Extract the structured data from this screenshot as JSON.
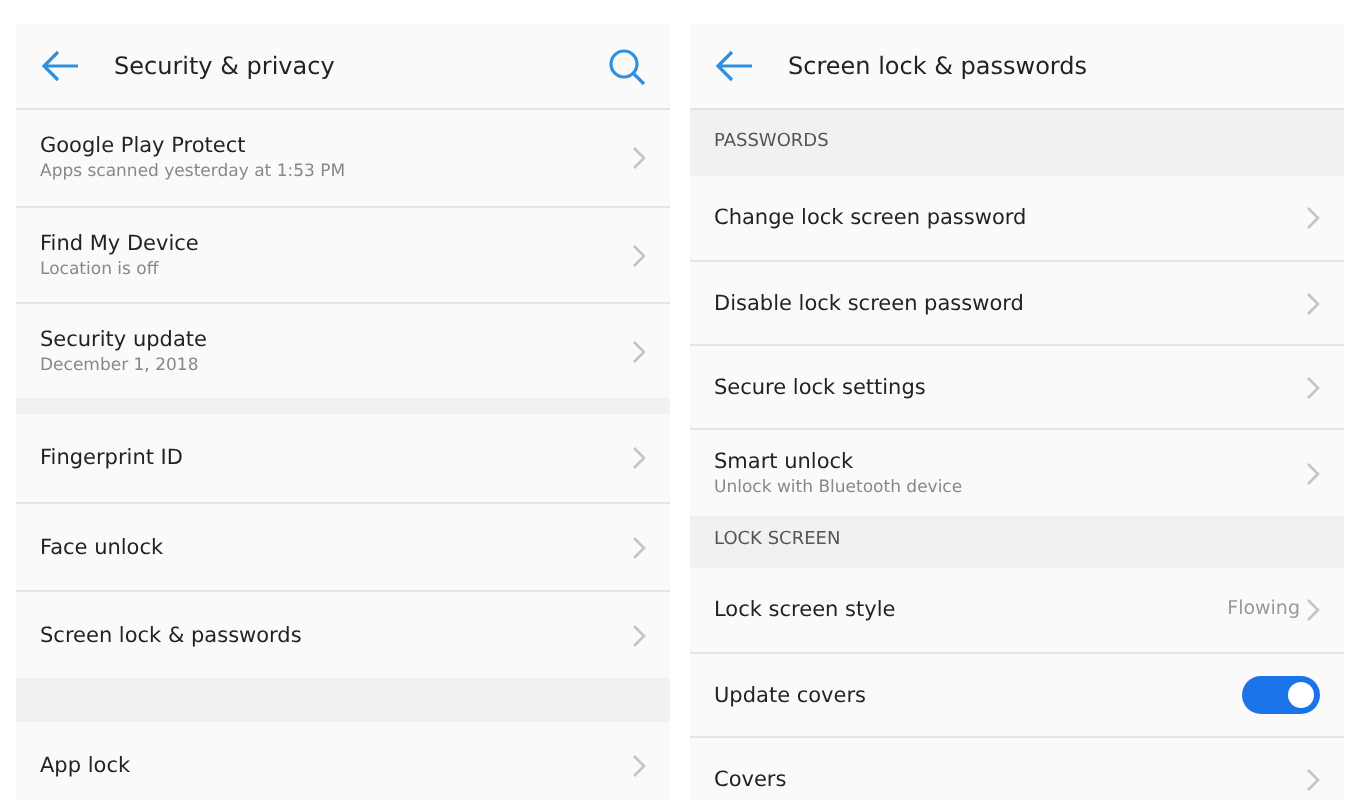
{
  "panels": [
    {
      "title": "Security & privacy",
      "search_button": true,
      "sections": [
        {
          "items": [
            {
              "kind": "link",
              "title": "Google Play Protect",
              "subtitle": "Apps scanned yesterday at 1:53 PM"
            },
            {
              "kind": "link",
              "title": "Find My Device",
              "subtitle": "Location is off"
            },
            {
              "kind": "link",
              "title": "Security update",
              "subtitle": "December 1, 2018"
            }
          ]
        },
        {
          "items": [
            {
              "kind": "link",
              "title": "Fingerprint ID"
            },
            {
              "kind": "link",
              "title": "Face unlock"
            },
            {
              "kind": "link",
              "title": "Screen lock & passwords"
            }
          ]
        },
        {
          "items": [
            {
              "kind": "link",
              "title": "App lock"
            }
          ]
        }
      ]
    },
    {
      "title": "Screen lock & passwords",
      "sections": [
        {
          "header": "PASSWORDS",
          "items": [
            {
              "kind": "link",
              "title": "Change lock screen password"
            },
            {
              "kind": "link",
              "title": "Disable lock screen password"
            },
            {
              "kind": "link",
              "title": "Secure lock settings"
            },
            {
              "kind": "link",
              "title": "Smart unlock",
              "subtitle": "Unlock with Bluetooth device"
            }
          ]
        },
        {
          "header": "LOCK SCREEN",
          "items": [
            {
              "kind": "link",
              "title": "Lock screen style",
              "value": "Flowing"
            },
            {
              "kind": "toggle",
              "title": "Update covers",
              "on": true
            },
            {
              "kind": "link",
              "title": "Covers"
            }
          ]
        }
      ]
    }
  ]
}
